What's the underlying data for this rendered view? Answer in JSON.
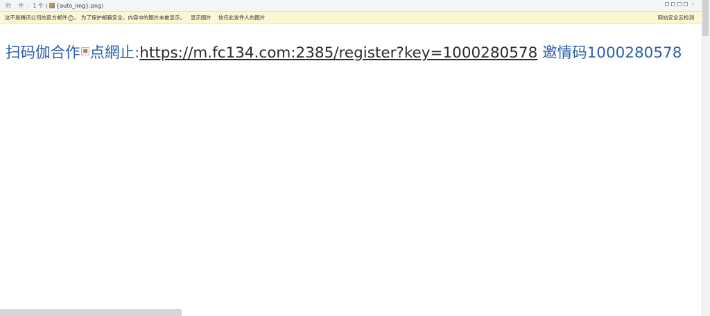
{
  "attachment": {
    "label": "附 件:",
    "count": "1 个",
    "paren_open": "(",
    "file_name": "{auto_img}.png",
    "paren_close": ")"
  },
  "warning": {
    "text_part1": "这不是腾讯公司的官方邮件",
    "help_glyph": "?",
    "text_part2": "。 为了保护邮箱安全，内容中的图片未被显示。",
    "show_images": "显示图片",
    "trust_sender": "信任此发件人的图片",
    "security_check": "网站安全云检测"
  },
  "message": {
    "prefix": "扫码伽合作",
    "suffix_before_link": "点網止:",
    "link": "https://m.fc134.com:2385/register?key=1000280578",
    "invite_label": " 邀情码",
    "invite_code": "1000280578"
  },
  "colors": {
    "message_text": "#2b5fae",
    "link_text": "#2b2b2b",
    "warning_bg": "#fbf6d4"
  },
  "icons": {
    "file": "image-file-icon",
    "broken_image": "broken-image-icon",
    "help": "help-icon"
  }
}
